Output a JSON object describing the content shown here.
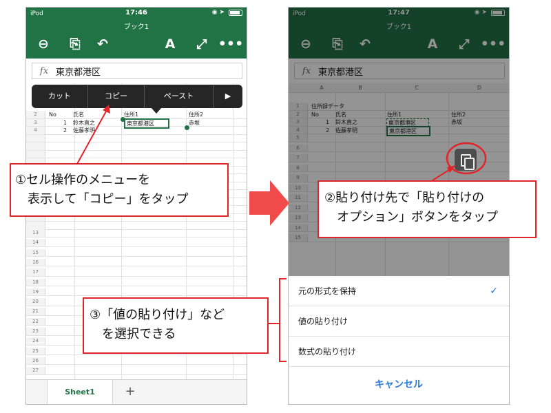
{
  "left_screen": {
    "status": {
      "carrier": "iPod",
      "time": "17:46"
    },
    "doc_title": "ブック1",
    "toolbar": {
      "spell_label": "A"
    },
    "formula": {
      "fx_label": "fx",
      "value": "東京都港区"
    },
    "context_menu": {
      "items": [
        "カット",
        "コピー",
        "ペースト",
        "▶"
      ]
    },
    "rows": [
      {
        "num": "2",
        "no": "No",
        "name": "氏名",
        "addr1": "住所1",
        "addr2": "住所2"
      },
      {
        "num": "3",
        "no": "1",
        "name": "鈴木直之",
        "addr1": "東京都港区",
        "addr2": "赤坂"
      },
      {
        "num": "4",
        "no": "2",
        "name": "佐藤孝明",
        "addr1": "",
        "addr2": ""
      }
    ],
    "extra_row_numbers": [
      "13",
      "14",
      "15",
      "16",
      "17",
      "18",
      "19",
      "20",
      "21",
      "22",
      "23",
      "24",
      "25",
      "26",
      "27"
    ],
    "tabs": {
      "sheet_name": "Sheet1",
      "add_label": "+"
    }
  },
  "right_screen": {
    "status": {
      "carrier": "iPod",
      "time": "17:47"
    },
    "doc_title": "ブック1",
    "formula": {
      "fx_label": "fx",
      "value": "東京都港区"
    },
    "columns": [
      "A",
      "B",
      "C",
      "D"
    ],
    "rows": [
      {
        "num": "1",
        "no": "住所録データ",
        "name": "",
        "addr1": "",
        "addr2": ""
      },
      {
        "num": "2",
        "no": "No",
        "name": "氏名",
        "addr1": "住所1",
        "addr2": "住所2"
      },
      {
        "num": "3",
        "no": "1",
        "name": "鈴木直之",
        "addr1": "東京都港区",
        "addr2": "赤坂"
      },
      {
        "num": "4",
        "no": "2",
        "name": "佐藤孝明",
        "addr1": "東京都港区",
        "addr2": ""
      }
    ],
    "empty_row_numbers": [
      "5",
      "6",
      "7",
      "8",
      "9",
      "10",
      "11",
      "12",
      "13",
      "14",
      "15"
    ],
    "paste_options": {
      "items": [
        "元の形式を保持",
        "値の貼り付け",
        "数式の貼り付け"
      ],
      "checked_index": 0,
      "cancel_label": "キャンセル"
    }
  },
  "callouts": {
    "step1": [
      "①セル操作のメニューを",
      "表示して「コピー」をタップ"
    ],
    "step2": [
      "②貼り付け先で「貼り付けの",
      "オプション」ボタンをタップ"
    ],
    "step3": [
      "③「値の貼り付け」など",
      "を選択できる"
    ]
  },
  "colors": {
    "excel_green": "#217346",
    "annotation_red": "#e0242a",
    "ios_blue": "#2b7ad9"
  }
}
